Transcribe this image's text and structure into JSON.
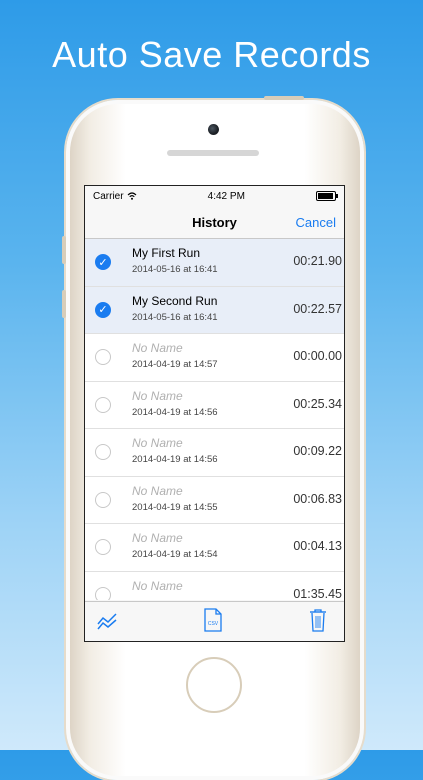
{
  "headline": "Auto Save Records",
  "status": {
    "carrier": "Carrier",
    "time": "4:42 PM"
  },
  "nav": {
    "title": "History",
    "cancel": "Cancel"
  },
  "records": [
    {
      "name": "My First Run",
      "date": "2014-05-16 at 16:41",
      "time": "00:21.90",
      "selected": true
    },
    {
      "name": "My Second Run",
      "date": "2014-05-16 at 16:41",
      "time": "00:22.57",
      "selected": true
    },
    {
      "name": "No Name",
      "date": "2014-04-19 at 14:57",
      "time": "00:00.00",
      "selected": false
    },
    {
      "name": "No Name",
      "date": "2014-04-19 at 14:56",
      "time": "00:25.34",
      "selected": false
    },
    {
      "name": "No Name",
      "date": "2014-04-19 at 14:56",
      "time": "00:09.22",
      "selected": false
    },
    {
      "name": "No Name",
      "date": "2014-04-19 at 14:55",
      "time": "00:06.83",
      "selected": false
    },
    {
      "name": "No Name",
      "date": "2014-04-19 at 14:54",
      "time": "00:04.13",
      "selected": false
    },
    {
      "name": "No Name",
      "date": "",
      "time": "01:35.45",
      "selected": false
    }
  ],
  "toolbar": {
    "chart_icon": "chart-icon",
    "csv_label": "CSV",
    "trash_icon": "trash-icon"
  },
  "colors": {
    "accent": "#1a7cf0",
    "background_top": "#2e9be8"
  }
}
